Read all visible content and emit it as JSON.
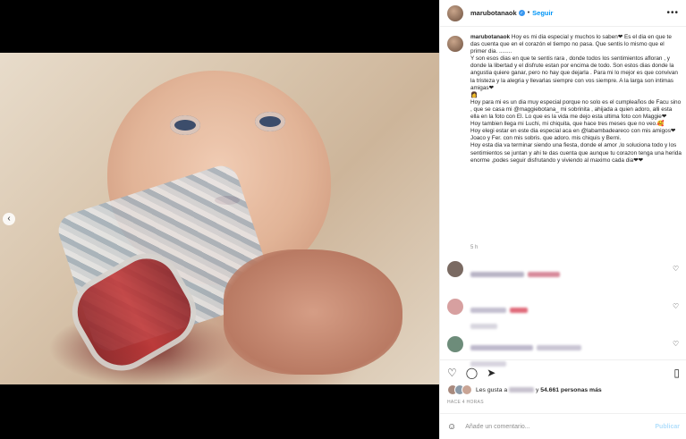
{
  "post": {
    "username": "marubotanaok",
    "separator": "•",
    "follow_label": "Seguir",
    "more_label": "•••"
  },
  "caption": {
    "username": "marubotanaok",
    "text": "Hoy es mi dia especial y muchos lo saben❤ Es el dia en que te das cuenta que en el corazón el tiempo no pasa. Que sentis lo mismo que el primer dia. ........\nY son esos dias en que te sentis rara , donde todos los sentimientos afloran , y donde la libertad y el disfrute estan por encima de todo. Son estos dias donde la angustia quiere ganar, pero no hay que dejarla . Para mi lo mejor es que convivan la tristeza y la alegria y llevarlas siempre con vos siempre. A la larga son intimas amigas❤\n👩\nHoy para mi es un dia muy especial porque no solo es el cumpleaños de Facu sino , que se casa mi @maggiebotana_ mi sobrinita , ahijada a quien adoro, alli esta ella en la foto con El. Lo que es la vida me dejo esta ultima foto con Maggie❤\nHoy tambien llega mi Luchi, mi chiquita, que hace tres meses que no veo.🥰\nHoy elegi estar en este dia especial aca en @labambadeareco con mis amigos❤ Joaco y Fer. con mis sobris. que adoro. mis chiquis y Berni.\nHoy esta dia va terminar siendo una fiesta, donde el amor ,lo soluciona todo y los sentimientos se juntan y ahi te das cuenta que aunque tu corazon tenga una herida enorme ,podes seguir disfrutando y viviendo al maximo cada dia❤❤",
    "time": "5 h"
  },
  "likes": {
    "prefix": "Les gusta a",
    "connector": "y",
    "count": "54.661 personas más"
  },
  "time_ago": "HACE 4 HORAS",
  "add_comment": {
    "placeholder": "Añade un comentario...",
    "publish_label": "Publicar"
  },
  "icons": {
    "prev": "chevron-left-icon",
    "like": "heart-icon",
    "comment": "comment-icon",
    "share": "paper-plane-icon",
    "save": "bookmark-icon",
    "emoji": "smiley-icon",
    "more": "ellipsis-icon"
  },
  "colors": {
    "accent": "#0095f6",
    "verified": "#3897f0",
    "active_dot": "#3897f0"
  },
  "carousel": {
    "slide_count": 5,
    "active_index": 3
  }
}
